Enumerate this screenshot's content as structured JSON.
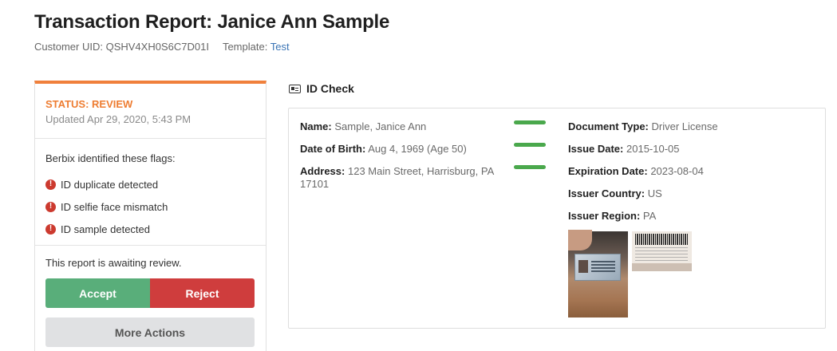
{
  "header": {
    "title": "Transaction Report: Janice Ann Sample",
    "customer_uid_label": "Customer UID:",
    "customer_uid": "QSHV4XH0S6C7D01I",
    "template_label": "Template:",
    "template_link": "Test"
  },
  "status_card": {
    "status": "STATUS: REVIEW",
    "updated": "Updated Apr 29, 2020, 5:43 PM",
    "accent_color": "#f0803c",
    "flags_title": "Berbix identified these flags:",
    "flags": [
      {
        "icon": "alert-icon",
        "label": "ID duplicate detected"
      },
      {
        "icon": "alert-icon",
        "label": "ID selfie face mismatch"
      },
      {
        "icon": "alert-icon",
        "label": "ID sample detected"
      }
    ],
    "review_text": "This report is awaiting review.",
    "accept_label": "Accept",
    "reject_label": "Reject",
    "more_label": "More Actions",
    "accept_color": "#59ae7a",
    "reject_color": "#cf3d3d"
  },
  "id_check": {
    "section_title": "ID Check",
    "section_icon": "id-card-icon",
    "left_fields": [
      {
        "label": "Name:",
        "value": "Sample, Janice Ann",
        "match": true
      },
      {
        "label": "Date of Birth:",
        "value": "Aug 4, 1969 (Age 50)",
        "match": true
      },
      {
        "label": "Address:",
        "value": "123 Main Street, Harrisburg, PA 17101",
        "match": true
      }
    ],
    "right_fields": [
      {
        "label": "Document Type:",
        "value": "Driver License"
      },
      {
        "label": "Issue Date:",
        "value": "2015-10-05"
      },
      {
        "label": "Expiration Date:",
        "value": "2023-08-04"
      },
      {
        "label": "Issuer Country:",
        "value": "US"
      },
      {
        "label": "Issuer Region:",
        "value": "PA"
      }
    ],
    "match_color": "#4aa84c"
  }
}
